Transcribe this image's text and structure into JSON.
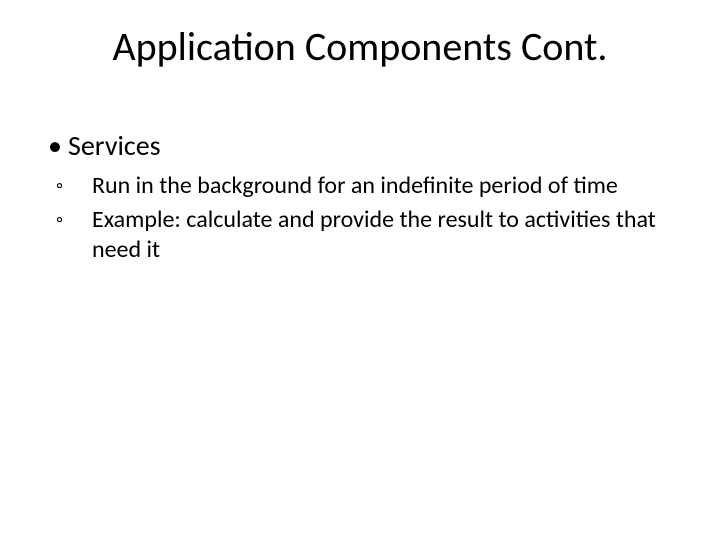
{
  "title": "Application Components Cont.",
  "bullets": {
    "item1": {
      "label": "Services",
      "sub": {
        "a": "Run in the background for an indefinite period of time",
        "b": "Example: calculate and provide the result to activities that need it"
      }
    }
  },
  "glyphs": {
    "dot": "•",
    "ring": "◦"
  }
}
